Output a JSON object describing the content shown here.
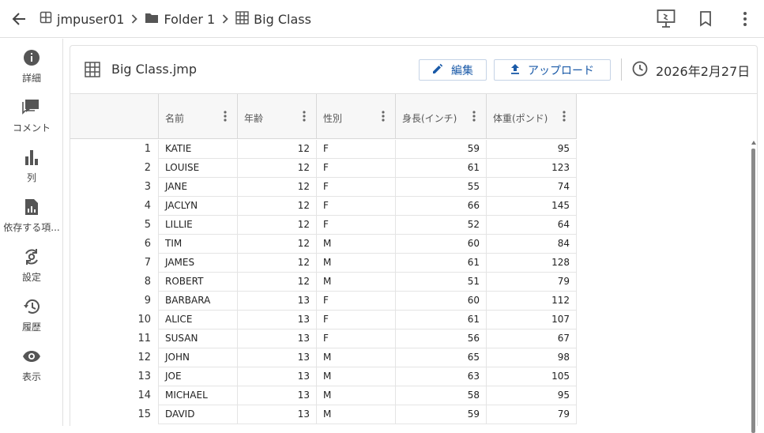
{
  "breadcrumb": {
    "items": [
      "jmpuser01",
      "Folder 1",
      "Big Class"
    ]
  },
  "sidebar": {
    "items": [
      {
        "label": "詳細",
        "icon": "info-icon"
      },
      {
        "label": "コメント",
        "icon": "comment-icon"
      },
      {
        "label": "列",
        "icon": "bar-chart-icon"
      },
      {
        "label": "依存する項...",
        "icon": "document-chart-icon"
      },
      {
        "label": "設定",
        "icon": "settings-sync-icon"
      },
      {
        "label": "履歴",
        "icon": "history-icon"
      },
      {
        "label": "表示",
        "icon": "eye-icon"
      }
    ]
  },
  "card": {
    "title": "Big Class.jmp",
    "edit_label": "編集",
    "upload_label": "アップロード",
    "date": "2026年2月27日"
  },
  "table": {
    "columns": [
      "名前",
      "年齢",
      "性別",
      "身長(インチ)",
      "体重(ポンド)"
    ],
    "rows": [
      {
        "n": "1",
        "name": "KATIE",
        "age": "12",
        "sex": "F",
        "height": "59",
        "weight": "95"
      },
      {
        "n": "2",
        "name": "LOUISE",
        "age": "12",
        "sex": "F",
        "height": "61",
        "weight": "123"
      },
      {
        "n": "3",
        "name": "JANE",
        "age": "12",
        "sex": "F",
        "height": "55",
        "weight": "74"
      },
      {
        "n": "4",
        "name": "JACLYN",
        "age": "12",
        "sex": "F",
        "height": "66",
        "weight": "145"
      },
      {
        "n": "5",
        "name": "LILLIE",
        "age": "12",
        "sex": "F",
        "height": "52",
        "weight": "64"
      },
      {
        "n": "6",
        "name": "TIM",
        "age": "12",
        "sex": "M",
        "height": "60",
        "weight": "84"
      },
      {
        "n": "7",
        "name": "JAMES",
        "age": "12",
        "sex": "M",
        "height": "61",
        "weight": "128"
      },
      {
        "n": "8",
        "name": "ROBERT",
        "age": "12",
        "sex": "M",
        "height": "51",
        "weight": "79"
      },
      {
        "n": "9",
        "name": "BARBARA",
        "age": "13",
        "sex": "F",
        "height": "60",
        "weight": "112"
      },
      {
        "n": "10",
        "name": "ALICE",
        "age": "13",
        "sex": "F",
        "height": "61",
        "weight": "107"
      },
      {
        "n": "11",
        "name": "SUSAN",
        "age": "13",
        "sex": "F",
        "height": "56",
        "weight": "67"
      },
      {
        "n": "12",
        "name": "JOHN",
        "age": "13",
        "sex": "M",
        "height": "65",
        "weight": "98"
      },
      {
        "n": "13",
        "name": "JOE",
        "age": "13",
        "sex": "M",
        "height": "63",
        "weight": "105"
      },
      {
        "n": "14",
        "name": "MICHAEL",
        "age": "13",
        "sex": "M",
        "height": "58",
        "weight": "95"
      },
      {
        "n": "15",
        "name": "DAVID",
        "age": "13",
        "sex": "M",
        "height": "59",
        "weight": "79"
      }
    ]
  },
  "colors": {
    "accent": "#1a5aa8",
    "border": "#e0e0e0",
    "icon": "#555555"
  }
}
